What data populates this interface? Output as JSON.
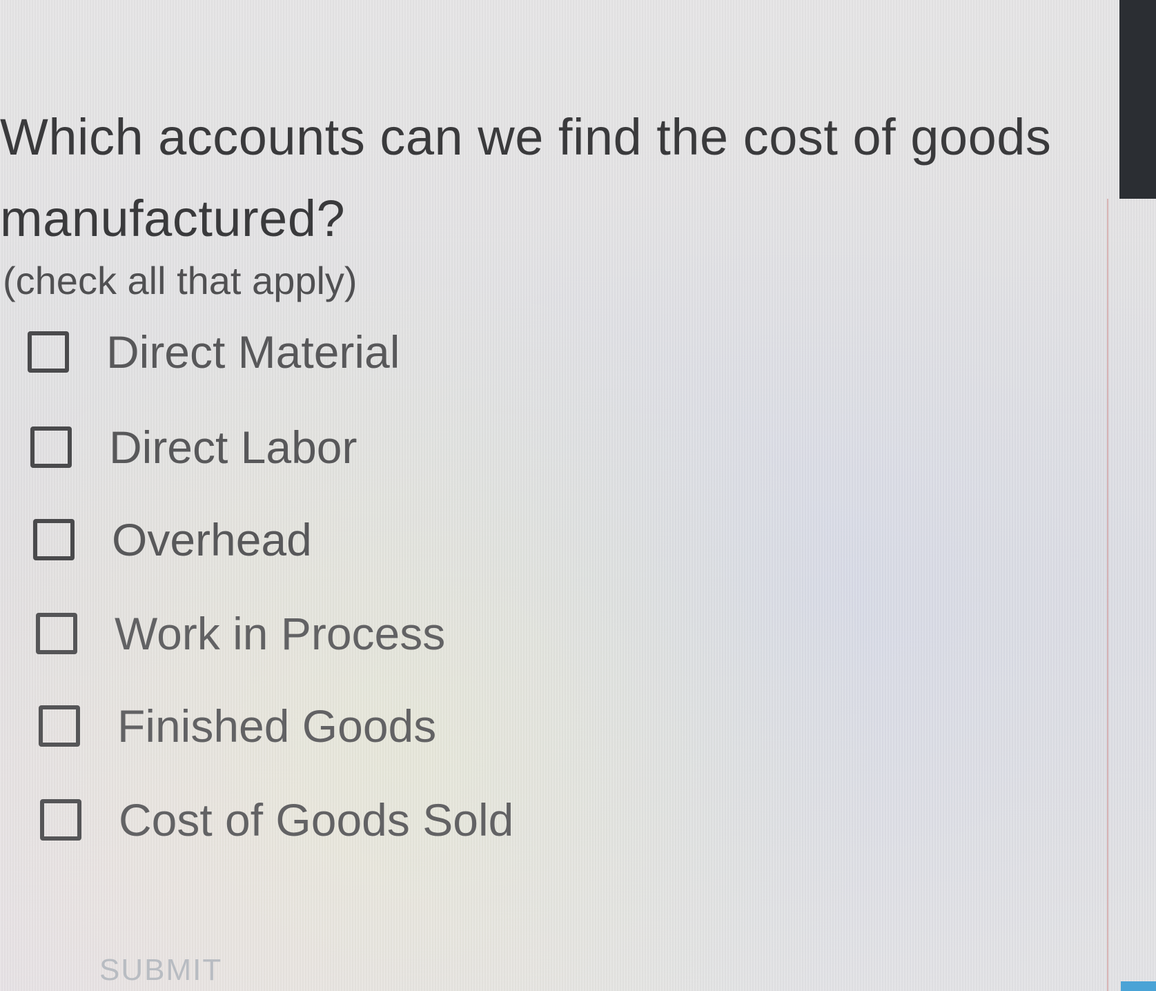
{
  "question": {
    "text": "Which accounts can we find the cost of goods manufactured?",
    "hint": "(check all that apply)"
  },
  "options": [
    {
      "label": "Direct Material",
      "checked": false
    },
    {
      "label": "Direct Labor",
      "checked": false
    },
    {
      "label": "Overhead",
      "checked": false
    },
    {
      "label": "Work in Process",
      "checked": false
    },
    {
      "label": "Finished Goods",
      "checked": false
    },
    {
      "label": "Cost of Goods Sold",
      "checked": false
    }
  ],
  "submit": {
    "label": "SUBMIT"
  },
  "colors": {
    "text": "#3a3a3c",
    "option_text": "#58585a",
    "checkbox_border": "#4a4a4c",
    "submit_text": "#b8bcc2",
    "dark_bar": "#2b2e33",
    "accent": "#4aa3d6"
  }
}
